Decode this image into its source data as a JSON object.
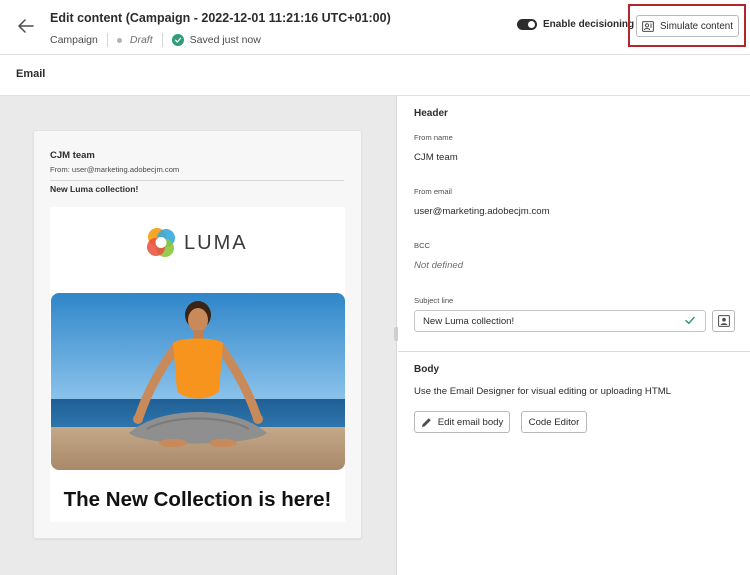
{
  "header": {
    "title": "Edit content (Campaign - 2022-12-01 11:21:16 UTC+01:00)",
    "type": "Campaign",
    "status": "Draft",
    "saved": "Saved just now",
    "toggle_label": "Enable decisioning",
    "toggle_on": true,
    "simulate_label": "Simulate content"
  },
  "section": {
    "title": "Email"
  },
  "preview": {
    "from_name": "CJM team",
    "from_email": "From: user@marketing.adobecjm.com",
    "subject": "New Luma collection!",
    "logo_text": "LUMA",
    "headline": "The New Collection is here!"
  },
  "panel": {
    "header_title": "Header",
    "from_name_label": "From name",
    "from_name_value": "CJM team",
    "from_email_label": "From email",
    "from_email_value": "user@marketing.adobecjm.com",
    "bcc_label": "BCC",
    "bcc_value": "Not defined",
    "subject_label": "Subject line",
    "subject_value": "New Luma collection!",
    "body_title": "Body",
    "body_desc": "Use the Email Designer for visual editing or uploading HTML",
    "edit_body_label": "Edit email body",
    "code_editor_label": "Code Editor"
  },
  "colors": {
    "highlight": "#b3262b",
    "success": "#2d9d78",
    "preview_bg": "#eaeaea"
  },
  "icons": [
    "arrow-left-icon",
    "checkmark-icon",
    "toggle-switch",
    "simulate-icon",
    "personalize-icon",
    "pencil-icon",
    "luma-logo-icon"
  ]
}
